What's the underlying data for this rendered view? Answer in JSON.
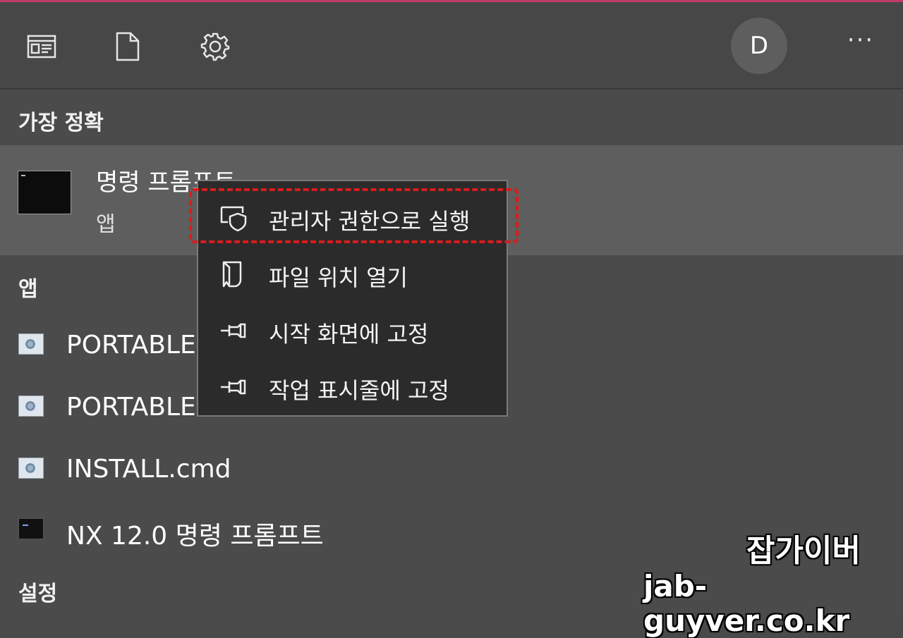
{
  "toolbar": {
    "icons": [
      "news-icon",
      "document-icon",
      "gear-icon"
    ],
    "avatar_letter": "D",
    "more_label": "···"
  },
  "sections": {
    "best_match": "가장 정확",
    "apps": "앱",
    "settings": "설정"
  },
  "best_match": {
    "title": "명령 프롬프트",
    "subtitle": "앱"
  },
  "apps": [
    {
      "label": "PORTABLE",
      "icon": "script-gear-icon"
    },
    {
      "label": "PORTABLE.",
      "icon": "script-gear-icon"
    },
    {
      "label": "INSTALL.cmd",
      "icon": "script-gear-icon"
    },
    {
      "label": "NX 12.0 명령 프롬프트",
      "icon": "console-icon"
    }
  ],
  "context_menu": {
    "items": [
      {
        "label": "관리자 권한으로 실행",
        "icon": "shield-window-icon"
      },
      {
        "label": "파일 위치 열기",
        "icon": "folder-open-icon"
      },
      {
        "label": "시작 화면에 고정",
        "icon": "pin-icon"
      },
      {
        "label": "작업 표시줄에 고정",
        "icon": "pin-icon"
      }
    ]
  },
  "watermark": {
    "name": "잡가이버",
    "site": "jab-guyver.co.kr"
  }
}
